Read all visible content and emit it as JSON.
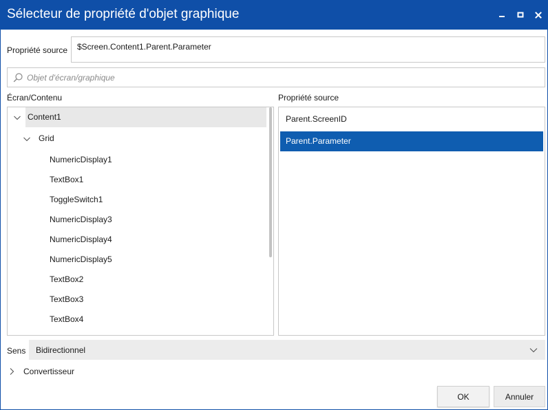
{
  "window": {
    "title": "Sélecteur de propriété d'objet graphique",
    "accent_color": "#0f4fa8",
    "selection_color": "#0f5db0",
    "controls": [
      "minimize-icon",
      "maximize-icon",
      "close-icon"
    ]
  },
  "source_property": {
    "label": "Propriété source",
    "value": "$Screen.Content1.Parent.Parameter"
  },
  "search": {
    "placeholder": "Objet d'écran/graphique",
    "value": ""
  },
  "tree": {
    "heading": "Écran/Contenu",
    "items": [
      {
        "label": "Content1",
        "expanded": true,
        "selected": true
      },
      {
        "label": "Grid",
        "expanded": true,
        "selected": false
      },
      {
        "label": "NumericDisplay1"
      },
      {
        "label": "TextBox1"
      },
      {
        "label": "ToggleSwitch1"
      },
      {
        "label": "NumericDisplay3"
      },
      {
        "label": "NumericDisplay4"
      },
      {
        "label": "NumericDisplay5"
      },
      {
        "label": "TextBox2"
      },
      {
        "label": "TextBox3"
      },
      {
        "label": "TextBox4"
      }
    ]
  },
  "properties": {
    "heading": "Propriété source",
    "items": [
      {
        "label": "Parent.ScreenID",
        "selected": false
      },
      {
        "label": "Parent.Parameter",
        "selected": true
      }
    ]
  },
  "direction": {
    "label": "Sens",
    "value": "Bidirectionnel"
  },
  "converter": {
    "label": "Convertisseur",
    "expanded": false
  },
  "buttons": {
    "ok": "OK",
    "cancel": "Annuler"
  }
}
